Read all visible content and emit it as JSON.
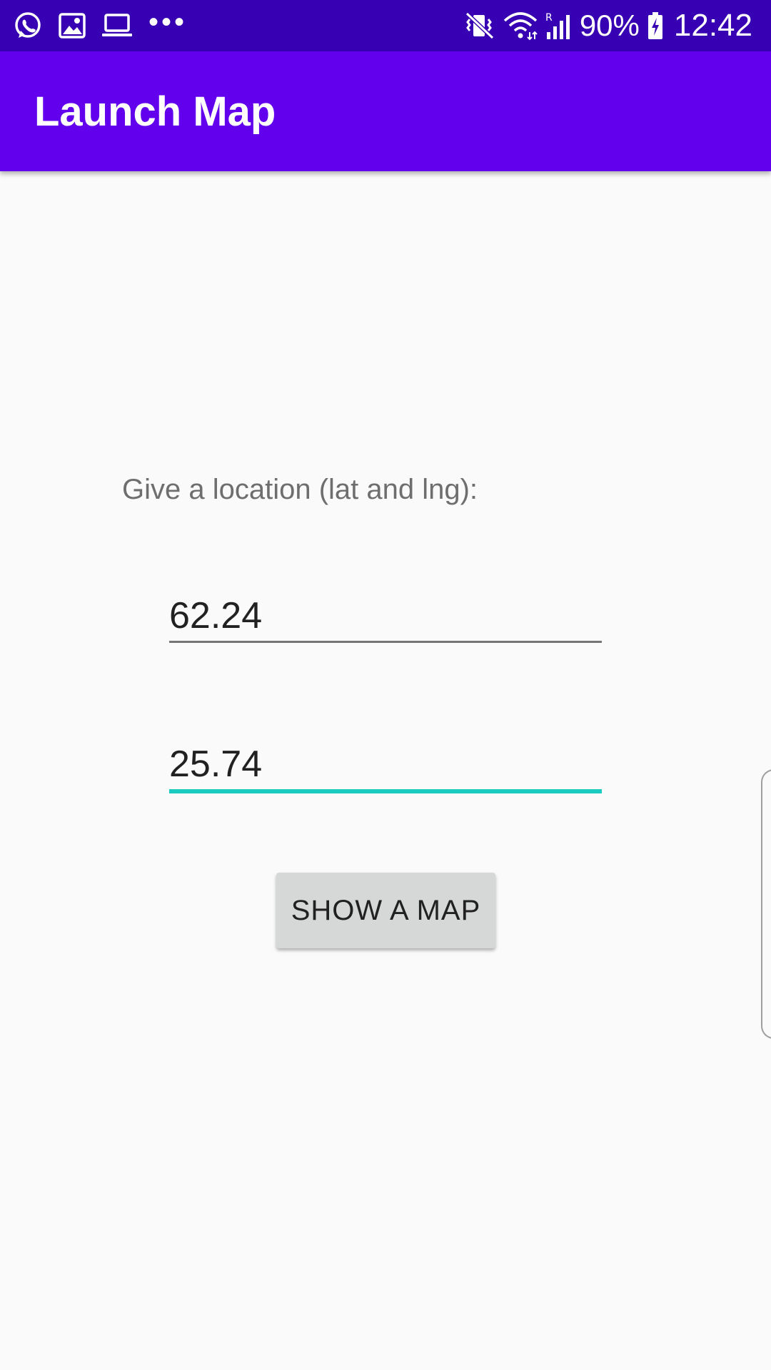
{
  "status_bar": {
    "left_icons": [
      "whatsapp-icon",
      "image-icon",
      "laptop-icon"
    ],
    "more_label": "•••",
    "right_icons": [
      "vibrate-icon",
      "wifi-icon",
      "signal-icon"
    ],
    "battery_percent": "90%",
    "battery_icon": "battery-charging-icon",
    "time": "12:42"
  },
  "app_bar": {
    "title": "Launch Map",
    "color": "#6200ee",
    "status_color": "#3700b3"
  },
  "form": {
    "prompt": "Give a location (lat and lng):",
    "latitude": "62.24",
    "longitude": "25.74",
    "focused_underline_color": "#1ccbc0"
  },
  "button": {
    "label": "SHOW A MAP"
  }
}
